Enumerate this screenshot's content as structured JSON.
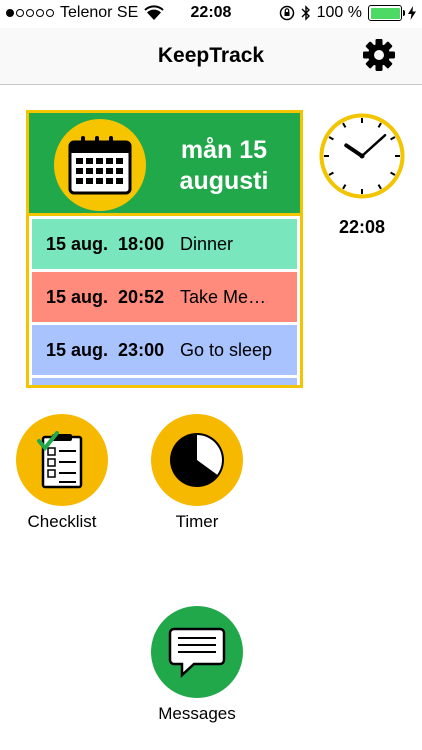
{
  "status_bar": {
    "carrier": "Telenor SE",
    "time": "22:08",
    "battery_percent": "100 %",
    "battery_level": 1.0,
    "signal_bars_filled": 1,
    "signal_bars_total": 5
  },
  "header": {
    "title": "KeepTrack",
    "settings_icon": "gear-icon"
  },
  "calendar": {
    "weekday_day": "mån 15",
    "month": "augusti",
    "icon": "calendar-icon",
    "events": [
      {
        "date": "15 aug.",
        "time": "18:00",
        "title": "Dinner",
        "color": "#79e6bd"
      },
      {
        "date": "15 aug.",
        "time": "20:52",
        "title": "Take Me…",
        "color": "#ff8b7d"
      },
      {
        "date": "15 aug.",
        "time": "23:00",
        "title": "Go to sleep",
        "color": "#a9c3ff"
      }
    ]
  },
  "clock": {
    "time": "22:08",
    "hour": 22,
    "minute": 8
  },
  "apps": {
    "checklist": {
      "label": "Checklist",
      "icon": "checklist-icon",
      "color": "#f7b800"
    },
    "timer": {
      "label": "Timer",
      "icon": "timer-icon",
      "color": "#f7b800"
    },
    "messages": {
      "label": "Messages",
      "icon": "message-icon",
      "color": "#21a84b"
    }
  },
  "colors": {
    "accent_yellow": "#f3c400",
    "calendar_green": "#21a84b"
  }
}
